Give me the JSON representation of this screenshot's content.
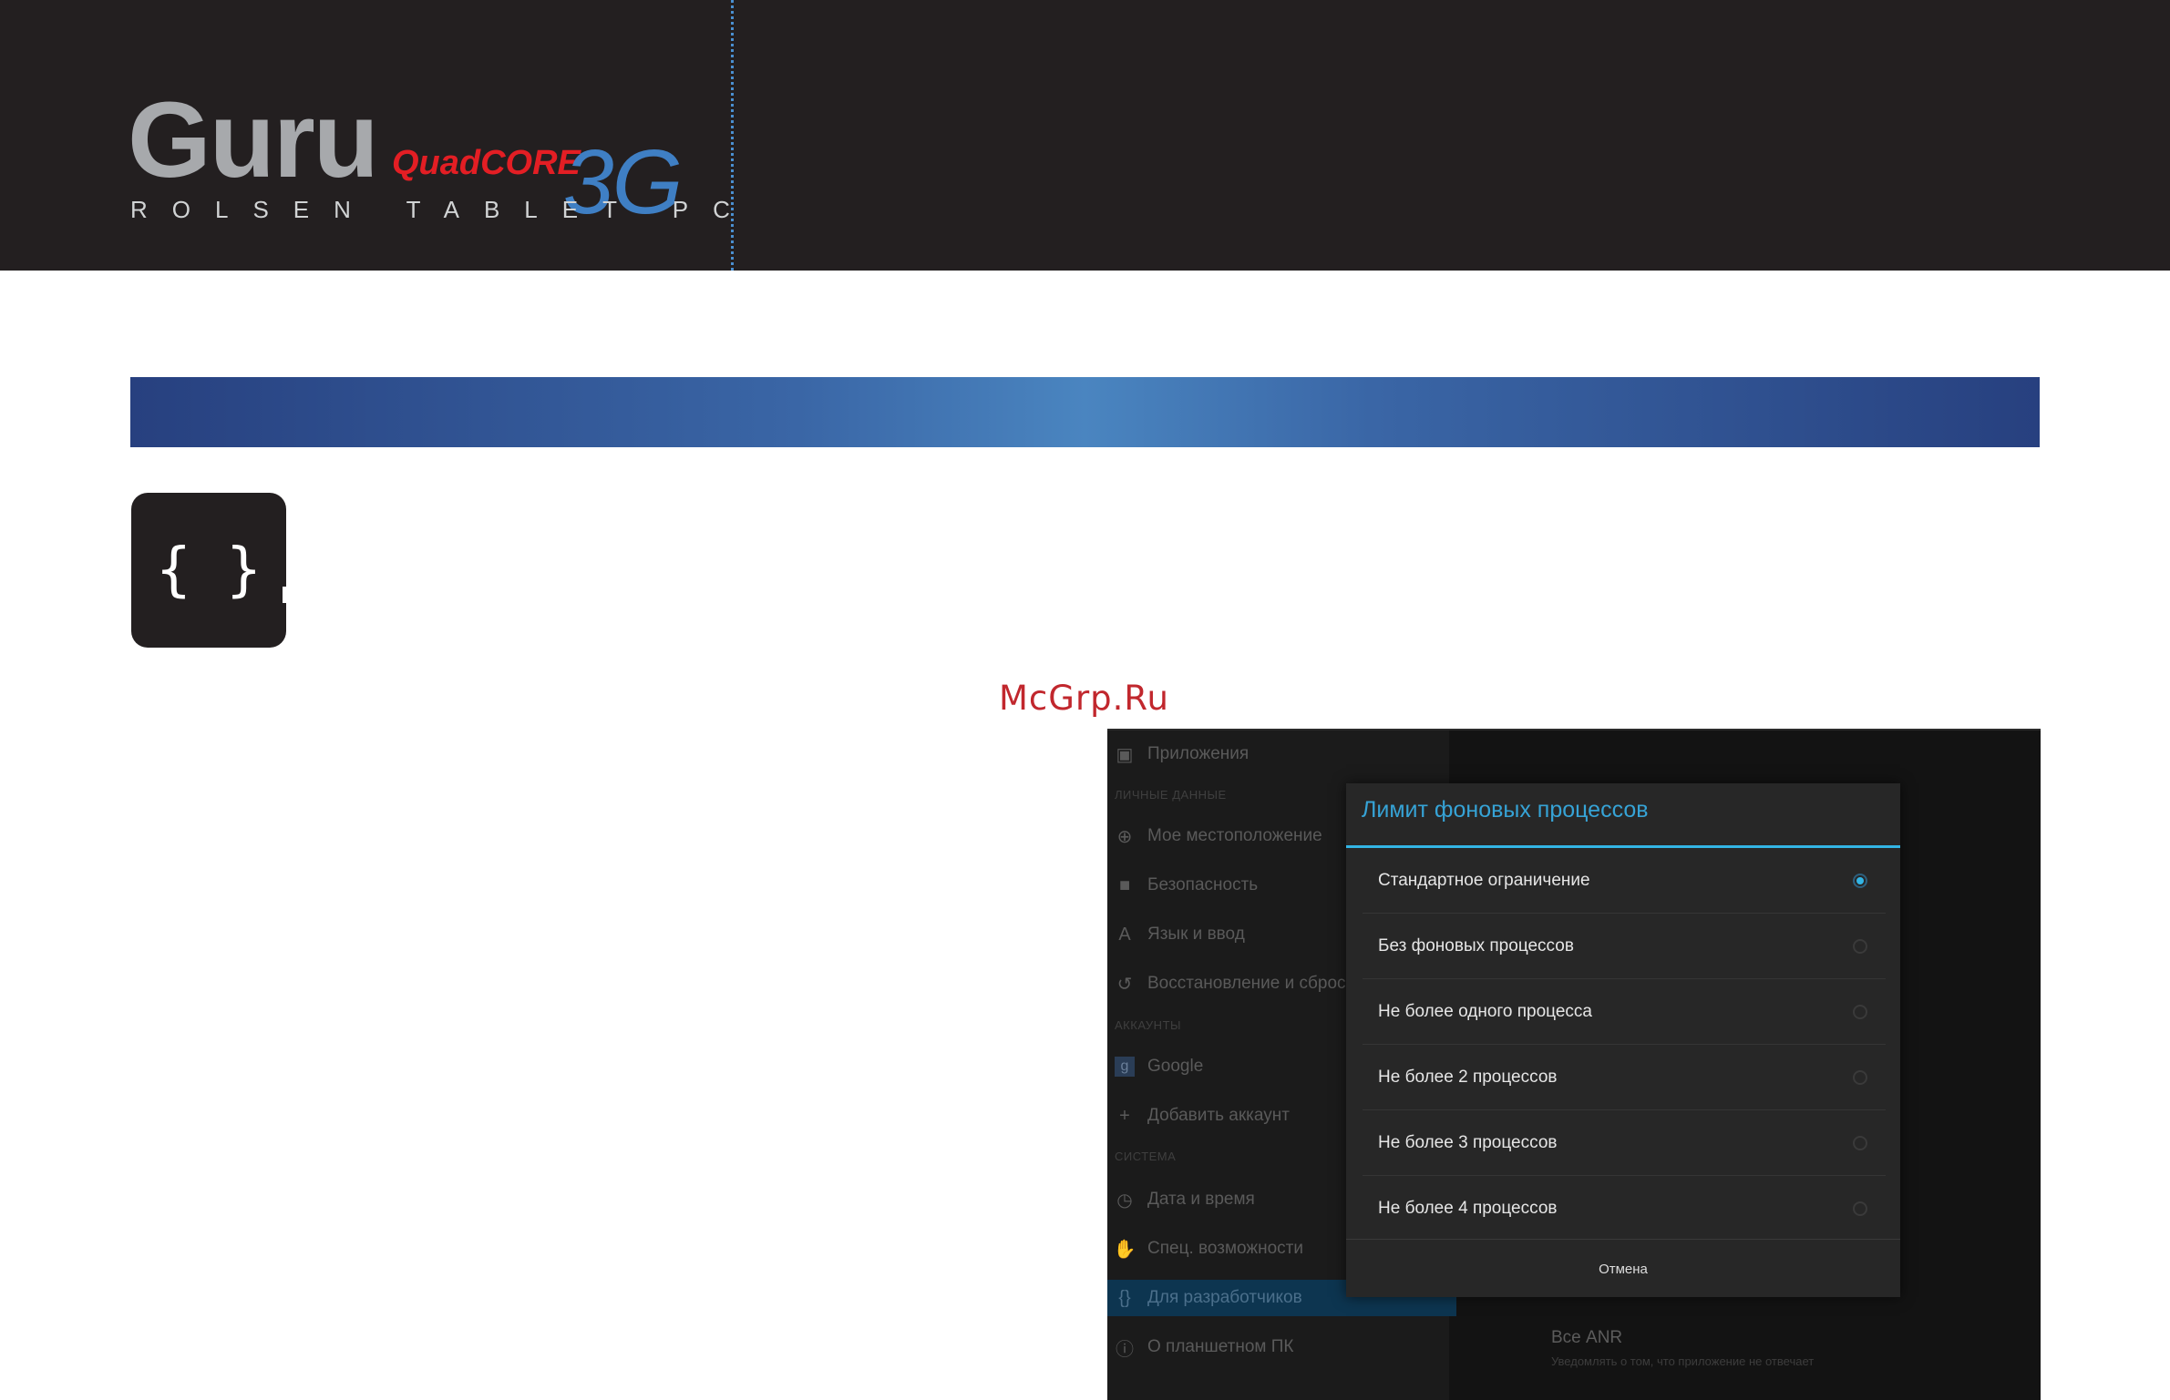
{
  "brand": {
    "name": "Guru",
    "quad": "QuadCORE",
    "net": "3G",
    "subtitle": "ROLSEN TABLET PC"
  },
  "dev_icon": "{ }",
  "watermark": "McGrp.Ru",
  "settings": {
    "apps": "Приложения",
    "section_personal": "Личные данные",
    "location": "Мое местоположение",
    "security": "Безопасность",
    "language": "Язык и ввод",
    "backup": "Восстановление и сброс",
    "section_accounts": "Аккаунты",
    "google": "Google",
    "add_account": "Добавить аккаунт",
    "section_system": "Система",
    "datetime": "Дата и время",
    "accessibility": "Спец. возможности",
    "developer": "Для разработчиков",
    "about": "О планшетном ПК"
  },
  "right_pane": {
    "anr_title": "Все ANR",
    "anr_sub": "Уведомлять о том, что приложение не отвечает"
  },
  "dialog": {
    "title": "Лимит фоновых процессов",
    "options": [
      {
        "label": "Стандартное ограничение",
        "selected": true
      },
      {
        "label": "Без фоновых процессов",
        "selected": false
      },
      {
        "label": "Не более одного процесса",
        "selected": false
      },
      {
        "label": "Не более 2 процессов",
        "selected": false
      },
      {
        "label": "Не более 3 процессов",
        "selected": false
      },
      {
        "label": "Не более 4 процессов",
        "selected": false
      }
    ],
    "cancel": "Отмена"
  },
  "colors": {
    "header_bg": "#231f20",
    "accent_blue": "#33b5e5",
    "logo_red": "#e31e24",
    "logo_blue": "#3f7fc4"
  }
}
